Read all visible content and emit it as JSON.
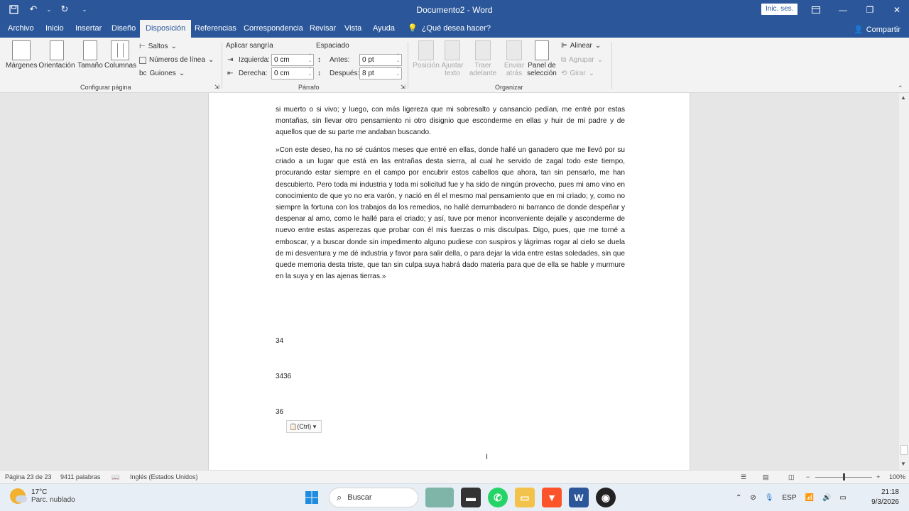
{
  "window": {
    "title": "Documento2 - Word",
    "signin_label": "Inic. ses.",
    "qat_customize": "⌄"
  },
  "menu": {
    "tabs": [
      "Archivo",
      "Inicio",
      "Insertar",
      "Diseño",
      "Disposición",
      "Referencias",
      "Correspondencia",
      "Revisar",
      "Vista",
      "Ayuda"
    ],
    "active_tab": "Disposición",
    "tell_me": "¿Qué desea hacer?",
    "share": "Compartir"
  },
  "ribbon": {
    "page_setup": {
      "margins": "Márgenes",
      "orientation": "Orientación",
      "size": "Tamaño",
      "columns": "Columnas",
      "breaks": "Saltos",
      "line_numbers": "Números de línea",
      "hyphenation": "Guiones",
      "group_label": "Configurar página"
    },
    "paragraph": {
      "indent_title": "Aplicar sangría",
      "left_label": "Izquierda:",
      "left_value": "0 cm",
      "right_label": "Derecha:",
      "right_value": "0 cm",
      "spacing_title": "Espaciado",
      "before_label": "Antes:",
      "before_value": "0 pt",
      "after_label": "Después:",
      "after_value": "8 pt",
      "group_label": "Párrafo"
    },
    "arrange": {
      "position": "Posición",
      "wrap_1": "Ajustar",
      "wrap_2": "texto",
      "forward_1": "Traer",
      "forward_2": "adelante",
      "backward_1": "Enviar",
      "backward_2": "atrás",
      "selection_1": "Panel de",
      "selection_2": "selección",
      "align": "Alinear",
      "group": "Agrupar",
      "rotate": "Girar",
      "group_label": "Organizar"
    }
  },
  "document": {
    "paragraph_1": "si muerto o si vivo; y luego, con más ligereza que mi sobresalto y cansancio pedían, me entré por estas montañas, sin llevar otro pensamiento ni otro disignio que esconderme en ellas y huir de mi padre y de aquellos que de su parte me andaban buscando.",
    "paragraph_2": "»Con este deseo, ha no sé cuántos meses que entré en ellas, donde hallé un ganadero que me llevó por su criado a un lugar que está en las entrañas desta sierra, al cual he servido de zagal todo este tiempo, procurando estar siempre en el campo por encubrir estos cabellos que ahora, tan sin pensarlo, me han descubierto. Pero toda mi industria y toda mi solicitud fue y ha sido de ningún provecho, pues mi amo vino en conocimiento de que yo no era varón, y nació en él el mesmo mal pensamiento que en mi criado; y, como no siempre la fortuna con los trabajos da los remedios, no hallé derrumbadero ni barranco de donde despeñar y despenar al amo, como le hallé para el criado; y así, tuve por menor inconveniente dejalle y asconderme de nuevo entre estas asperezas que probar con él mis fuerzas o mis disculpas. Digo, pues, que me torné a emboscar, y a buscar donde sin impedimento alguno pudiese con suspiros y lágrimas rogar al cielo se duela de mi desventura y me dé industria y favor para salir della, o para dejar la vida entre estas soledades, sin que quede memoria desta triste, que tan sin culpa suya habrá dado materia para que de ella se hable y murmure en la suya y en las ajenas tierras.»",
    "line_1": "34",
    "line_2": "3436",
    "line_3": "36",
    "paste_options": "(Ctrl)"
  },
  "status": {
    "page": "Página 23 de 23",
    "words": "9411 palabras",
    "language": "Inglés (Estados Unidos)",
    "zoom": "100%"
  },
  "taskbar": {
    "temperature": "17°C",
    "weather": "Parc. nublado",
    "search_placeholder": "Buscar",
    "language": "ESP",
    "time": "21:18",
    "date": "9/3/2026"
  },
  "colors": {
    "word_blue": "#2b579a",
    "ribbon_bg": "#f3f3f3",
    "canvas_bg": "#e6e6e6"
  }
}
